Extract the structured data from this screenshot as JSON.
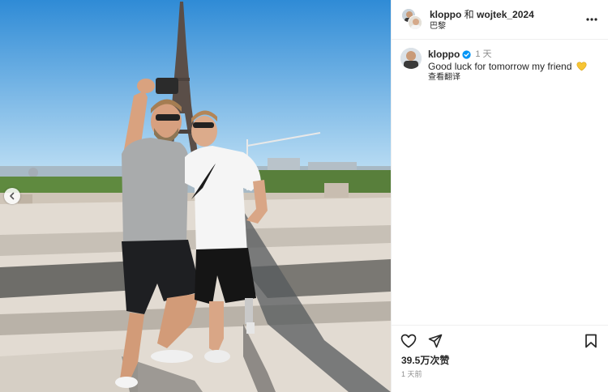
{
  "post": {
    "author": "kloppo",
    "connector": "和",
    "coauthor": "wojtek_2024",
    "location": "巴黎"
  },
  "icons": {
    "more": "more-horizontal-icon",
    "verified": "verified-badge-icon",
    "like": "heart-outline-icon",
    "share": "send-icon",
    "save": "bookmark-icon",
    "carousel_prev": "chevron-left-icon",
    "emoji": "yellow-heart-emoji"
  },
  "comment": {
    "username": "kloppo",
    "time": "1 天",
    "text": "Good luck for tomorrow my friend",
    "translate": "查看翻译"
  },
  "footer": {
    "likes": "39.5万次赞",
    "posted": "1 天前"
  },
  "colors": {
    "verified_blue": "#0095f6",
    "emoji_yellow": "#f7c534",
    "sky": "#8cc6ee",
    "divider": "#efefef"
  }
}
